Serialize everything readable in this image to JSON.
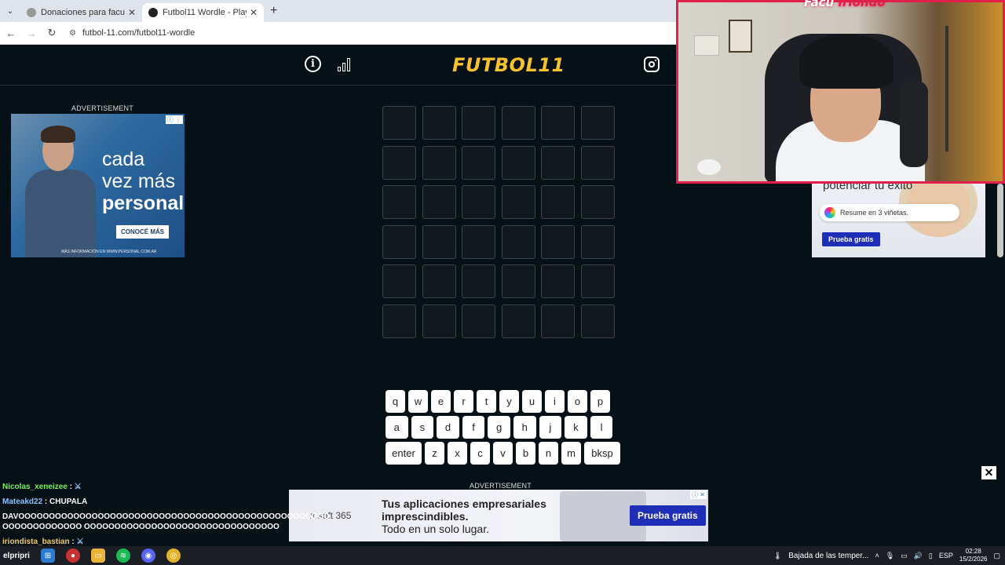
{
  "browser": {
    "tabs": [
      {
        "title": "Donaciones para facuiriondo | C",
        "active": false
      },
      {
        "title": "Futbol11 Wordle - Play Footbal",
        "active": true
      }
    ],
    "new_tab": "+",
    "url": "futbol-11.com/futbol11-wordle"
  },
  "site": {
    "logo_text": "FUTBOL",
    "logo_num": "11",
    "icons": [
      "info-icon",
      "stats-icon",
      "instagram-icon"
    ],
    "logo_color": "#f7c12e"
  },
  "ad_label": "ADVERTISEMENT",
  "ad_left": {
    "line1": "cada",
    "line2": "vez más",
    "line3": "personal",
    "cta": "CONOCÉ MÁS",
    "fine_print": "MÁS INFORMACIÓN EN WWW.PERSONAL.COM.AR"
  },
  "ad_right": {
    "heading": "potenciar tu éxito",
    "pill_text": "Resume en 3 viñetas.",
    "button": "Prueba gratis"
  },
  "ad_bottom": {
    "brand": "rosoft 365",
    "line1": "Tus aplicaciones empresariales",
    "line2": "imprescindibles.",
    "line3": "Todo en un solo lugar.",
    "button": "Prueba gratis"
  },
  "grid": {
    "rows": 6,
    "cols": 6
  },
  "keyboard": {
    "row1": [
      "q",
      "w",
      "e",
      "r",
      "t",
      "y",
      "u",
      "i",
      "o",
      "p"
    ],
    "row2": [
      "a",
      "s",
      "d",
      "f",
      "g",
      "h",
      "j",
      "k",
      "l"
    ],
    "row3": [
      "enter",
      "z",
      "x",
      "c",
      "v",
      "b",
      "n",
      "m",
      "bksp"
    ]
  },
  "stream": {
    "title_a": "Facu ",
    "title_b": "Iriondo"
  },
  "chat": [
    {
      "user": "Nicolas_xeneizee",
      "text": ""
    },
    {
      "user": "Mateakd22",
      "text": "CHUPALA"
    },
    {
      "user": "",
      "text": "DAVOOOOOOOOOOOOOOOOOOOOOOOOOOOOOOOOOOOOOOOOOOOOOOOOOOOOOOOOOOOOOOOO OOOOOOOOOOOOOOOOOOOOOOOOOOOOOOOO"
    },
    {
      "user": "iriondista_bastian",
      "text": ""
    }
  ],
  "taskbar": {
    "left_user": "elpripri",
    "weather": "Bajada de las temper...",
    "lang": "ESP",
    "time": "02:28",
    "date": "15/2/2026"
  }
}
